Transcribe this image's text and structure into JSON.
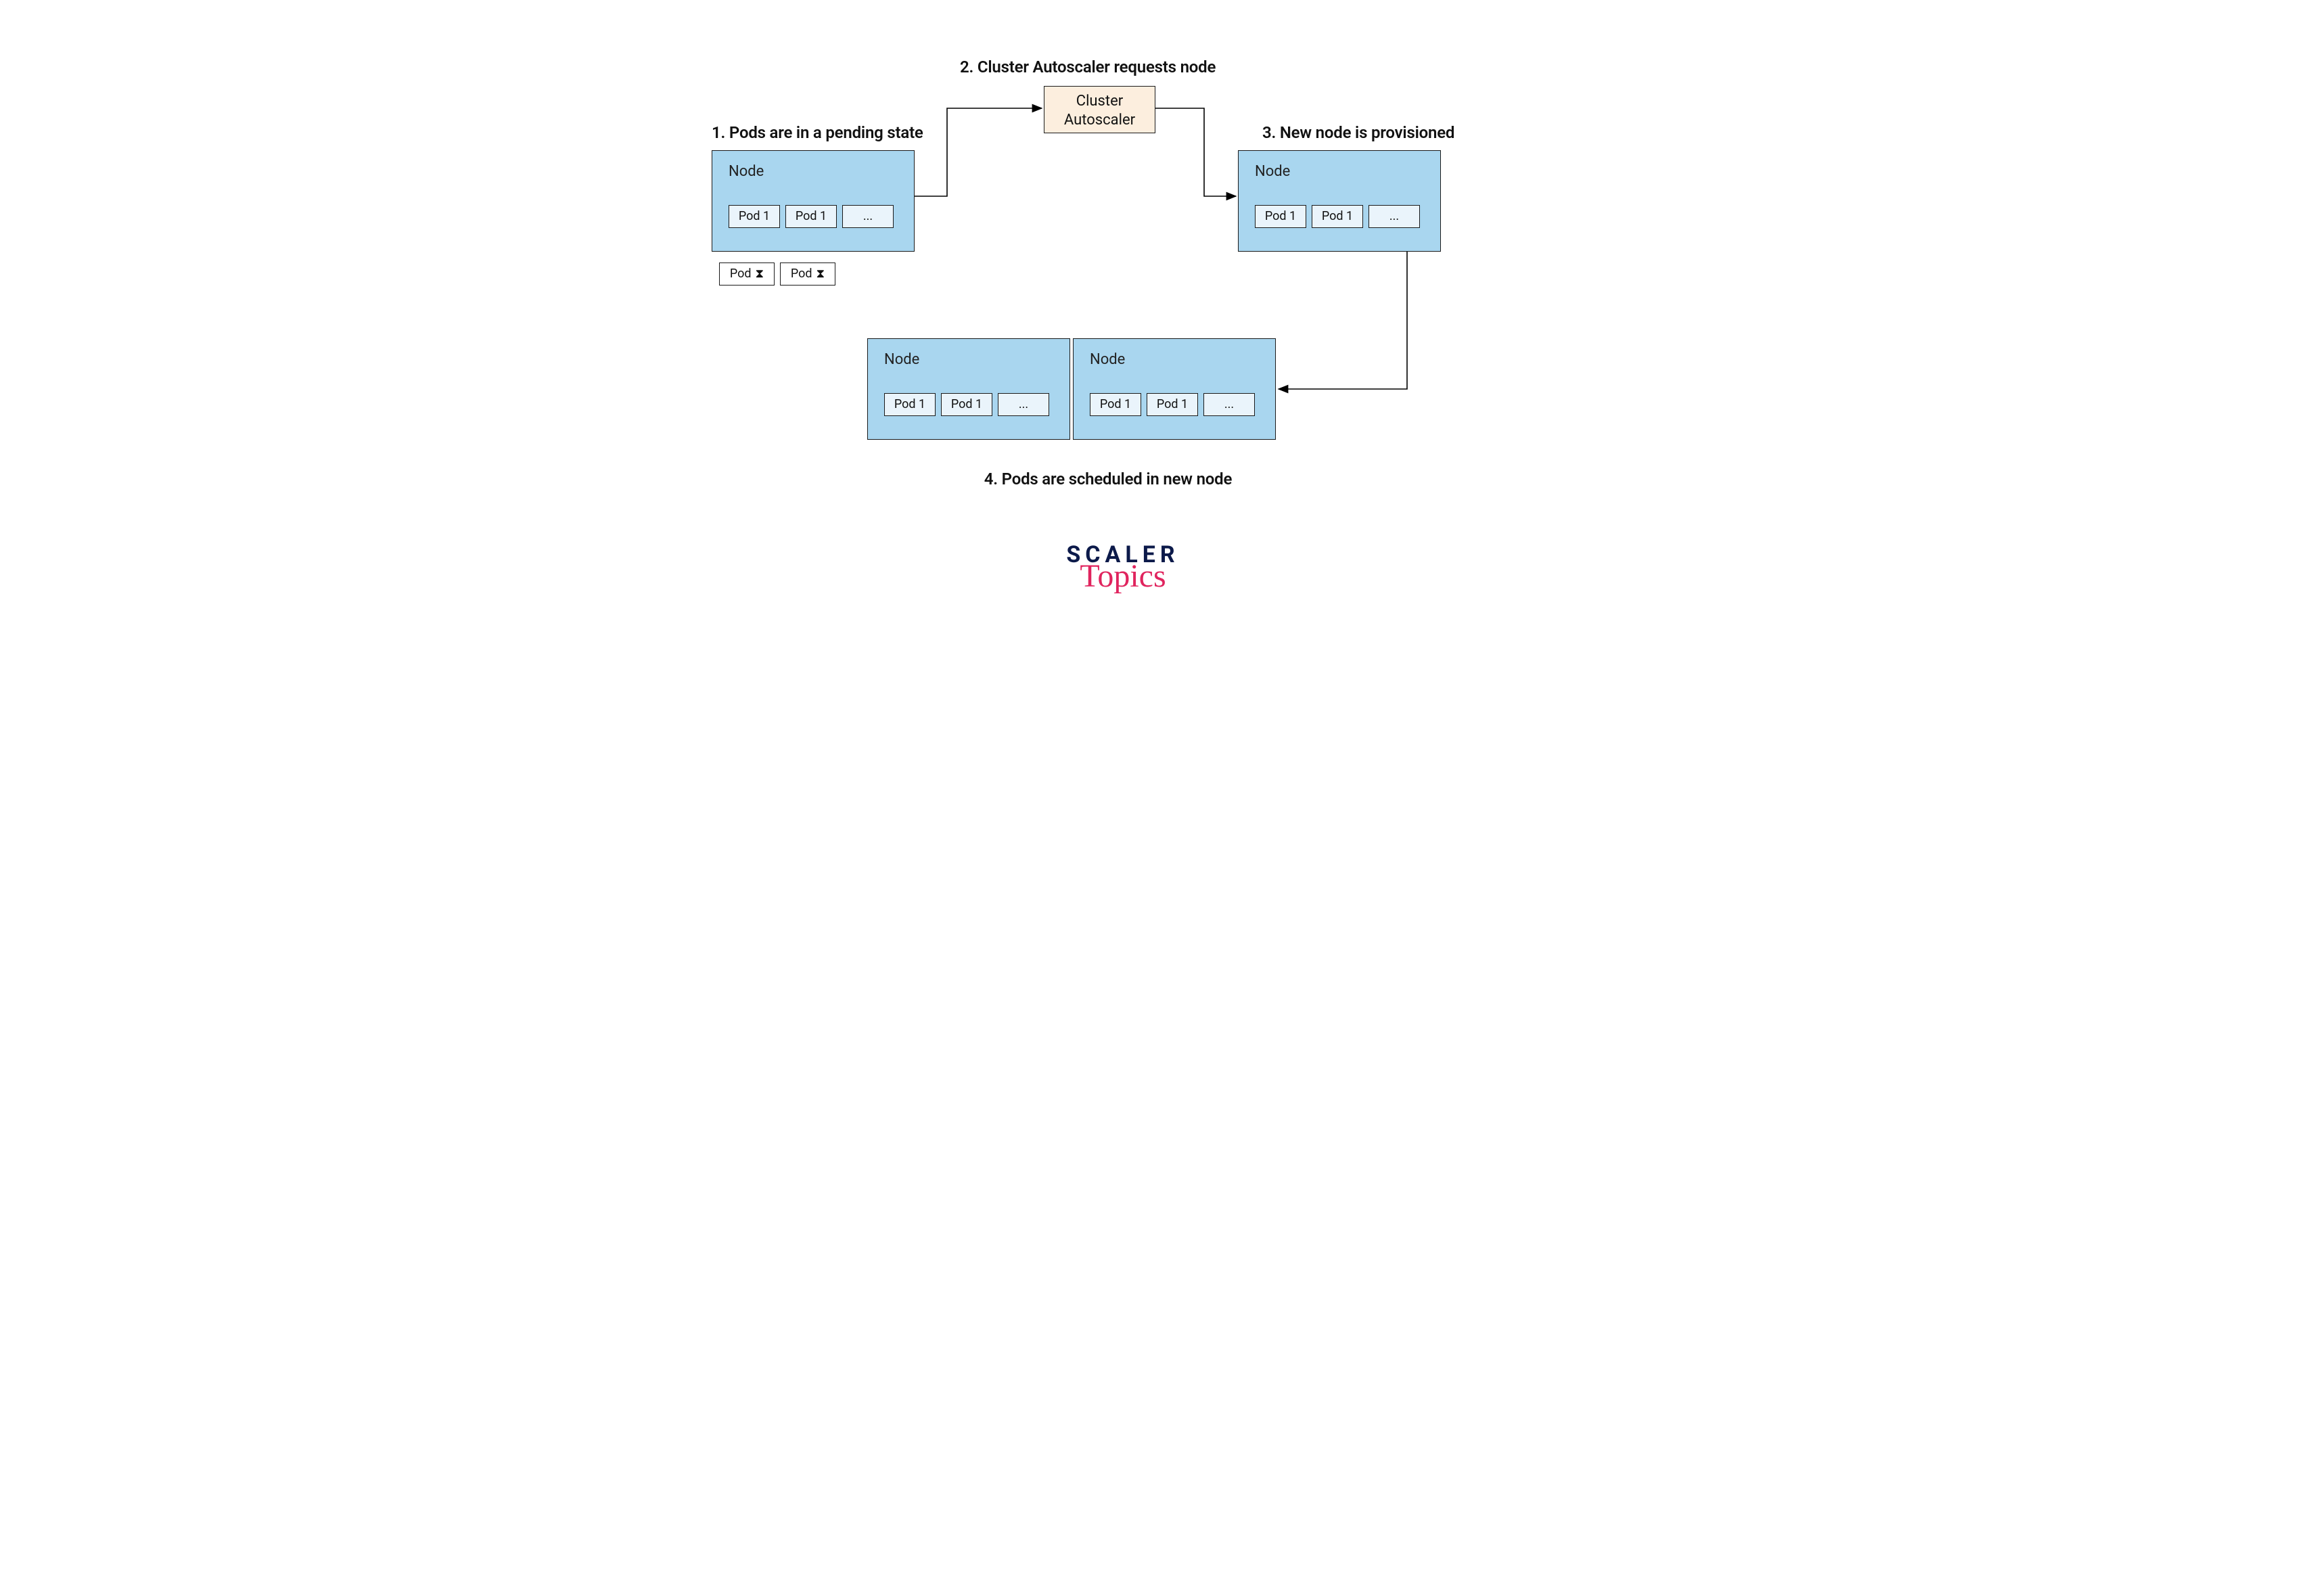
{
  "steps": {
    "s1": "1. Pods are in a pending state",
    "s2": "2. Cluster Autoscaler requests node",
    "s3": "3. New node is provisioned",
    "s4": "4. Pods are scheduled in new node"
  },
  "labels": {
    "node": "Node",
    "autoscaler_l1": "Cluster",
    "autoscaler_l2": "Autoscaler",
    "pod1": "Pod 1",
    "dots": "...",
    "pending_pod": "Pod"
  },
  "branding": {
    "line1": "SCALER",
    "line2": "Topics"
  },
  "colors": {
    "node_fill": "#a9d6ef",
    "pod_fill": "#eaf4fb",
    "autoscaler_fill": "#fceede",
    "stroke": "#1a1a1a",
    "brand_dark": "#0c1a4a",
    "brand_pink": "#e0245e"
  }
}
